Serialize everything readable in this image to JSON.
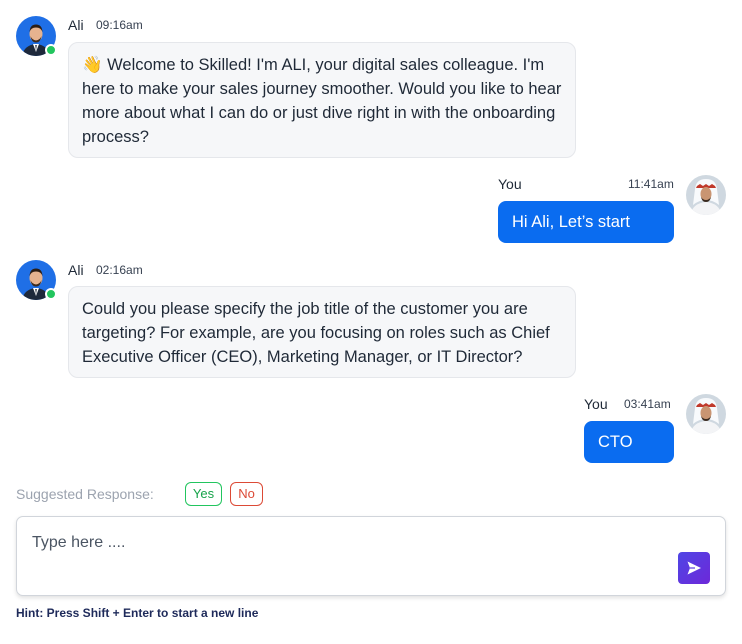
{
  "messages": [
    {
      "sender": "Ali",
      "time": "09:16am",
      "emoji": "👋",
      "text": "Welcome to Skilled! I'm ALI, your digital sales colleague. I'm here to make your sales journey smoother. Would you like to hear more about what I can do or just dive right in with the onboarding process?"
    },
    {
      "sender": "You",
      "time": "11:41am",
      "text": "Hi Ali, Let’s start"
    },
    {
      "sender": "Ali",
      "time": "02:16am",
      "text": "Could you please specify the job title of the customer you are targeting? For example, are you focusing on roles such as Chief Executive Officer (CEO), Marketing Manager, or IT Director?"
    },
    {
      "sender": "You",
      "time": "03:41am",
      "text": "CTO"
    }
  ],
  "suggested": {
    "label": "Suggested Response:",
    "options": [
      "Yes",
      "No"
    ]
  },
  "composer": {
    "placeholder": "Type here ...."
  },
  "hint": "Hint: Press Shift + Enter to start a new line",
  "colors": {
    "outgoing_bubble": "#0a6cf0",
    "incoming_bubble": "#f6f7f9",
    "online_status": "#22c55e",
    "yes_chip": "#22c55e",
    "no_chip": "#dc4a36",
    "send_button": "#5b3de0"
  },
  "icons": {
    "send": "send-arrow-icon",
    "status": "online-status-icon"
  }
}
